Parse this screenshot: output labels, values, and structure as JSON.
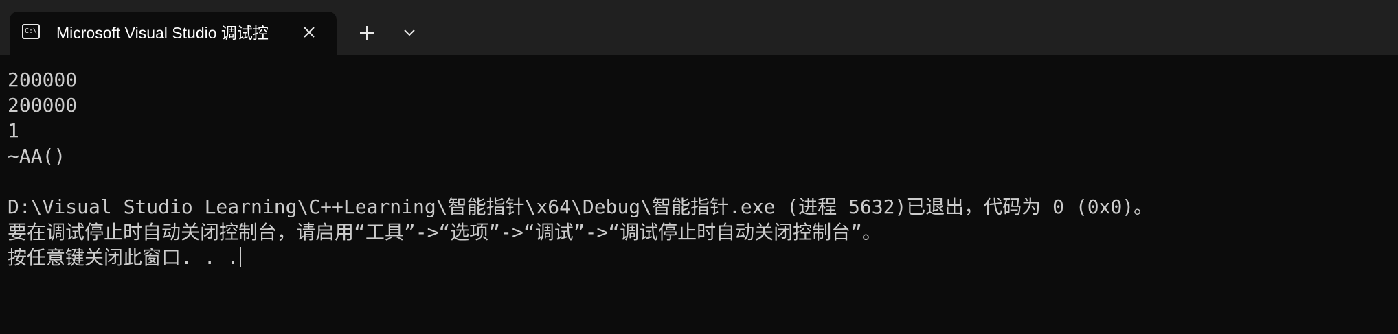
{
  "tab": {
    "icon_text": "C:\\",
    "title": "Microsoft Visual Studio 调试控"
  },
  "icons": {
    "tab_icon": "console-icon",
    "close": "close-icon",
    "new_tab": "plus-icon",
    "dropdown": "chevron-down-icon"
  },
  "colors": {
    "titlebar": "#202020",
    "background": "#0c0c0c",
    "text": "#cccccc"
  },
  "console": {
    "lines": [
      "200000",
      "200000",
      "1",
      "~AA()",
      "",
      "D:\\Visual Studio Learning\\C++Learning\\智能指针\\x64\\Debug\\智能指针.exe (进程 5632)已退出，代码为 0 (0x0)。",
      "要在调试停止时自动关闭控制台，请启用“工具”->“选项”->“调试”->“调试停止时自动关闭控制台”。",
      "按任意键关闭此窗口. . ."
    ]
  }
}
